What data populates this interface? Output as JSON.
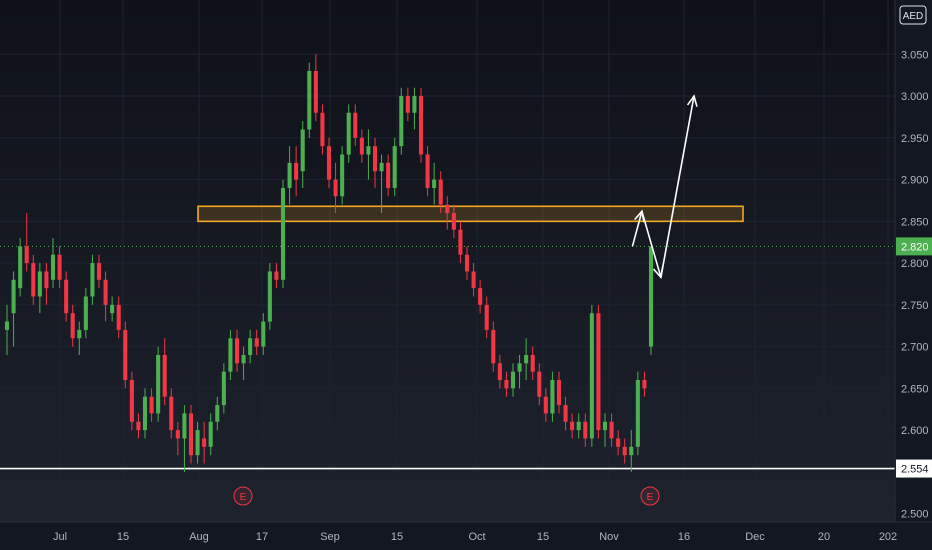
{
  "chart_data": {
    "type": "candlestick",
    "currency": "AED",
    "ylim": [
      2.49,
      3.115
    ],
    "y_ticks": [
      "3.050",
      "3.000",
      "2.950",
      "2.900",
      "2.850",
      "2.800",
      "2.750",
      "2.700",
      "2.650",
      "2.600",
      "2.500"
    ],
    "x_ticks": [
      "Jul",
      "15",
      "Aug",
      "17",
      "Sep",
      "15",
      "Oct",
      "15",
      "Nov",
      "16",
      "Dec",
      "20",
      "202"
    ],
    "last_price": "2.820",
    "last_price_value": 2.82,
    "support_level": "2.554",
    "support_value": 2.554,
    "resistance_zone": [
      2.85,
      2.868
    ],
    "earnings_markers": [
      "E",
      "E"
    ],
    "projection_path": [
      {
        "date": "Nov 10",
        "price": 2.82
      },
      {
        "date": "Nov 12",
        "price": 2.862
      },
      {
        "date": "Nov 16",
        "price": 2.783
      },
      {
        "date": "Nov 23",
        "price": 3.0
      }
    ],
    "candles": [
      [
        2.72,
        2.75,
        2.69,
        2.73
      ],
      [
        2.74,
        2.79,
        2.7,
        2.78
      ],
      [
        2.77,
        2.83,
        2.76,
        2.82
      ],
      [
        2.82,
        2.86,
        2.79,
        2.8
      ],
      [
        2.8,
        2.81,
        2.75,
        2.76
      ],
      [
        2.76,
        2.8,
        2.74,
        2.79
      ],
      [
        2.79,
        2.8,
        2.75,
        2.77
      ],
      [
        2.78,
        2.83,
        2.77,
        2.81
      ],
      [
        2.81,
        2.82,
        2.77,
        2.78
      ],
      [
        2.78,
        2.79,
        2.73,
        2.74
      ],
      [
        2.74,
        2.75,
        2.7,
        2.71
      ],
      [
        2.71,
        2.73,
        2.69,
        2.72
      ],
      [
        2.72,
        2.77,
        2.71,
        2.76
      ],
      [
        2.76,
        2.81,
        2.75,
        2.8
      ],
      [
        2.8,
        2.81,
        2.77,
        2.78
      ],
      [
        2.78,
        2.79,
        2.73,
        2.75
      ],
      [
        2.74,
        2.76,
        2.73,
        2.75
      ],
      [
        2.75,
        2.76,
        2.71,
        2.72
      ],
      [
        2.72,
        2.73,
        2.65,
        2.66
      ],
      [
        2.66,
        2.67,
        2.6,
        2.61
      ],
      [
        2.61,
        2.62,
        2.59,
        2.6
      ],
      [
        2.6,
        2.65,
        2.59,
        2.64
      ],
      [
        2.64,
        2.65,
        2.61,
        2.62
      ],
      [
        2.62,
        2.7,
        2.61,
        2.69
      ],
      [
        2.69,
        2.71,
        2.63,
        2.64
      ],
      [
        2.64,
        2.65,
        2.59,
        2.6
      ],
      [
        2.6,
        2.61,
        2.57,
        2.59
      ],
      [
        2.59,
        2.63,
        2.55,
        2.62
      ],
      [
        2.62,
        2.63,
        2.56,
        2.57
      ],
      [
        2.57,
        2.61,
        2.56,
        2.6
      ],
      [
        2.59,
        2.61,
        2.56,
        2.58
      ],
      [
        2.58,
        2.62,
        2.57,
        2.61
      ],
      [
        2.61,
        2.64,
        2.6,
        2.63
      ],
      [
        2.63,
        2.68,
        2.62,
        2.67
      ],
      [
        2.67,
        2.72,
        2.66,
        2.71
      ],
      [
        2.71,
        2.72,
        2.67,
        2.68
      ],
      [
        2.68,
        2.7,
        2.66,
        2.69
      ],
      [
        2.69,
        2.72,
        2.68,
        2.71
      ],
      [
        2.71,
        2.72,
        2.69,
        2.7
      ],
      [
        2.7,
        2.74,
        2.69,
        2.73
      ],
      [
        2.73,
        2.8,
        2.72,
        2.79
      ],
      [
        2.79,
        2.8,
        2.77,
        2.78
      ],
      [
        2.78,
        2.9,
        2.77,
        2.89
      ],
      [
        2.89,
        2.94,
        2.87,
        2.92
      ],
      [
        2.92,
        2.94,
        2.88,
        2.9
      ],
      [
        2.91,
        2.97,
        2.89,
        2.96
      ],
      [
        2.96,
        3.04,
        2.95,
        3.03
      ],
      [
        3.03,
        3.05,
        2.97,
        2.98
      ],
      [
        2.98,
        2.99,
        2.93,
        2.94
      ],
      [
        2.94,
        2.95,
        2.89,
        2.9
      ],
      [
        2.9,
        2.92,
        2.86,
        2.88
      ],
      [
        2.88,
        2.94,
        2.87,
        2.93
      ],
      [
        2.93,
        2.99,
        2.92,
        2.98
      ],
      [
        2.98,
        2.99,
        2.94,
        2.95
      ],
      [
        2.95,
        2.96,
        2.92,
        2.93
      ],
      [
        2.93,
        2.96,
        2.9,
        2.94
      ],
      [
        2.94,
        2.95,
        2.89,
        2.91
      ],
      [
        2.91,
        2.93,
        2.86,
        2.92
      ],
      [
        2.92,
        2.93,
        2.88,
        2.89
      ],
      [
        2.89,
        2.95,
        2.88,
        2.94
      ],
      [
        2.94,
        3.01,
        2.93,
        3.0
      ],
      [
        3.0,
        3.01,
        2.97,
        2.98
      ],
      [
        2.98,
        3.01,
        2.96,
        3.0
      ],
      [
        3.0,
        3.01,
        2.92,
        2.93
      ],
      [
        2.93,
        2.94,
        2.88,
        2.89
      ],
      [
        2.89,
        2.92,
        2.87,
        2.9
      ],
      [
        2.9,
        2.91,
        2.86,
        2.87
      ],
      [
        2.87,
        2.88,
        2.84,
        2.86
      ],
      [
        2.86,
        2.87,
        2.83,
        2.84
      ],
      [
        2.84,
        2.85,
        2.8,
        2.81
      ],
      [
        2.81,
        2.82,
        2.78,
        2.79
      ],
      [
        2.79,
        2.8,
        2.76,
        2.77
      ],
      [
        2.77,
        2.78,
        2.74,
        2.75
      ],
      [
        2.75,
        2.76,
        2.71,
        2.72
      ],
      [
        2.72,
        2.73,
        2.67,
        2.68
      ],
      [
        2.68,
        2.69,
        2.65,
        2.66
      ],
      [
        2.66,
        2.67,
        2.64,
        2.65
      ],
      [
        2.65,
        2.68,
        2.64,
        2.67
      ],
      [
        2.67,
        2.69,
        2.65,
        2.68
      ],
      [
        2.68,
        2.71,
        2.66,
        2.69
      ],
      [
        2.69,
        2.7,
        2.66,
        2.67
      ],
      [
        2.67,
        2.68,
        2.63,
        2.64
      ],
      [
        2.64,
        2.65,
        2.61,
        2.62
      ],
      [
        2.62,
        2.67,
        2.61,
        2.66
      ],
      [
        2.66,
        2.67,
        2.62,
        2.63
      ],
      [
        2.63,
        2.64,
        2.6,
        2.61
      ],
      [
        2.61,
        2.62,
        2.59,
        2.6
      ],
      [
        2.6,
        2.62,
        2.59,
        2.61
      ],
      [
        2.61,
        2.62,
        2.58,
        2.59
      ],
      [
        2.59,
        2.75,
        2.58,
        2.74
      ],
      [
        2.74,
        2.75,
        2.59,
        2.6
      ],
      [
        2.6,
        2.62,
        2.58,
        2.61
      ],
      [
        2.61,
        2.62,
        2.58,
        2.59
      ],
      [
        2.59,
        2.6,
        2.57,
        2.58
      ],
      [
        2.58,
        2.59,
        2.56,
        2.57
      ],
      [
        2.57,
        2.6,
        2.55,
        2.58
      ],
      [
        2.58,
        2.67,
        2.57,
        2.66
      ],
      [
        2.66,
        2.67,
        2.64,
        2.65
      ],
      [
        2.7,
        2.82,
        2.69,
        2.82
      ]
    ]
  },
  "colors": {
    "background": "#131722",
    "up": "#4caf50",
    "down": "#f23645",
    "zone_border": "#f5a623",
    "zone_fill": "#f5a623",
    "support_line": "#ffffff",
    "projection": "#ffffff",
    "last_price_tag": "#4caf50",
    "earnings": "#f23645"
  }
}
